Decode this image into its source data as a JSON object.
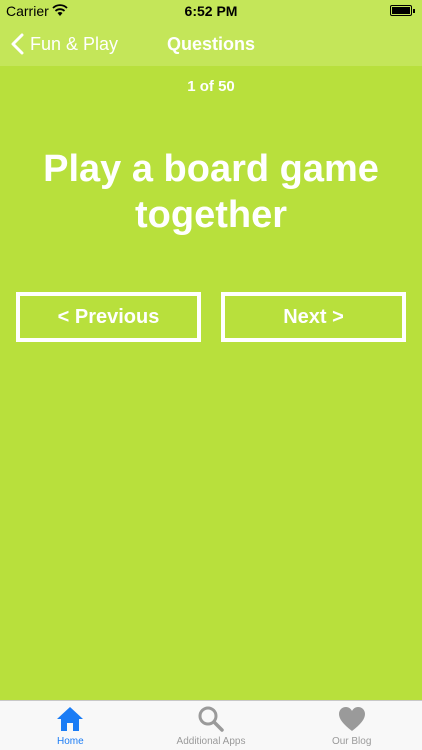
{
  "status_bar": {
    "carrier": "Carrier",
    "time": "6:52 PM"
  },
  "nav": {
    "back_label": "Fun & Play",
    "title": "Questions"
  },
  "content": {
    "counter": "1 of 50",
    "question": "Play a board game together",
    "prev_label": "< Previous",
    "next_label": "Next >"
  },
  "tabbar": {
    "items": [
      {
        "label": "Home",
        "icon": "home-icon",
        "active": true
      },
      {
        "label": "Additional Apps",
        "icon": "search-icon",
        "active": false
      },
      {
        "label": "Our Blog",
        "icon": "heart-icon",
        "active": false
      }
    ]
  },
  "colors": {
    "background": "#b8e03c",
    "bar": "#c4e659",
    "active_tab": "#1a7cf5",
    "inactive_tab": "#9a9a9a"
  }
}
